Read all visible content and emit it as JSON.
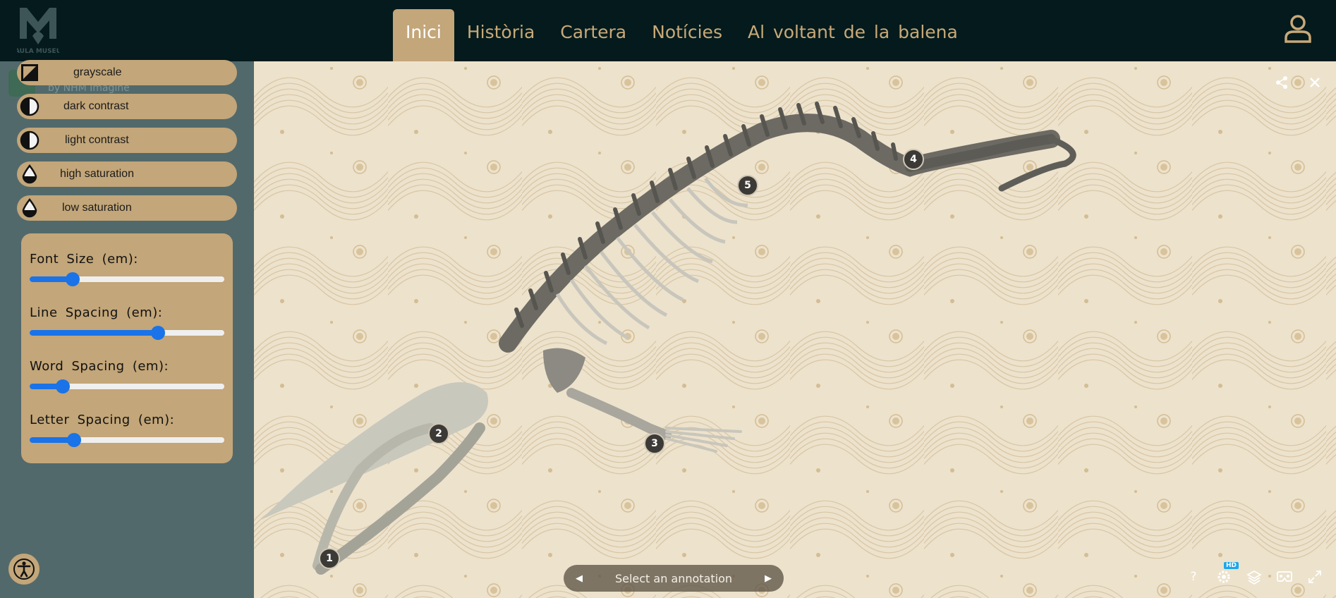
{
  "header": {
    "logo_text": "AULA MUSEU",
    "nav": [
      {
        "label": "Inici",
        "active": true
      },
      {
        "label": "Història",
        "active": false
      },
      {
        "label": "Cartera",
        "active": false
      },
      {
        "label": "Notícies",
        "active": false
      },
      {
        "label": "Al voltant de la balena",
        "active": false
      }
    ],
    "user_icon": "user-icon"
  },
  "background_overlay": {
    "byline": "by NHM Imagine"
  },
  "accessibility": {
    "filters": [
      {
        "label": "grayscale",
        "icon": "grayscale-icon"
      },
      {
        "label": "dark contrast",
        "icon": "contrast-icon"
      },
      {
        "label": "light contrast",
        "icon": "contrast-icon"
      },
      {
        "label": "high saturation",
        "icon": "saturation-icon"
      },
      {
        "label": "low saturation",
        "icon": "saturation-icon"
      }
    ],
    "sliders": [
      {
        "label": "Font Size (em):",
        "level": 0.22
      },
      {
        "label": "Line Spacing (em):",
        "level": 0.66
      },
      {
        "label": "Word Spacing (em):",
        "level": 0.17
      },
      {
        "label": "Letter Spacing (em):",
        "level": 0.23
      }
    ],
    "toggle_icon": "accessibility-icon"
  },
  "viewer": {
    "annotation_bar": {
      "label": "Select an annotation",
      "prev": "◀",
      "next": "▶"
    },
    "annotations": [
      "1",
      "2",
      "3",
      "4",
      "5"
    ],
    "hd_badge": "HD",
    "help_label": "?",
    "toolbar_icons": [
      "help-icon",
      "settings-icon",
      "layers-icon",
      "vr-icon",
      "fullscreen-icon"
    ],
    "top_icons": [
      "share-icon",
      "close-icon"
    ]
  },
  "colors": {
    "header_bg": "#041a1c",
    "accent_gold": "#c3a679",
    "nav_text": "#c8a979",
    "slider_blue": "#1a73e8",
    "viewer_bg": "#ece1cb"
  }
}
